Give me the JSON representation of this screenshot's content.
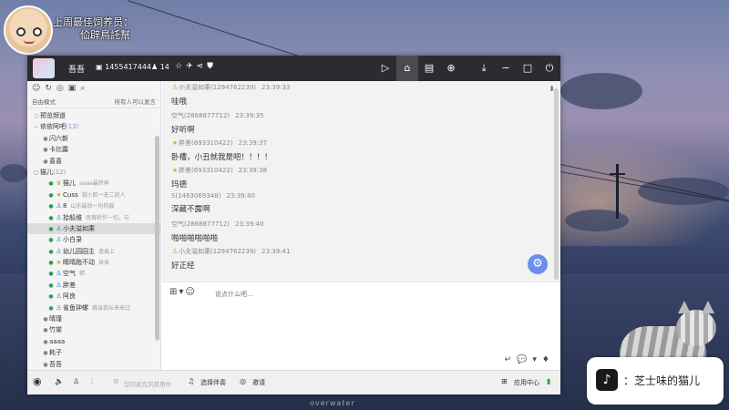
{
  "overlay": {
    "caption_line1": "上周最佳饲养员：",
    "caption_line2": "佡辟鳥託幫",
    "watermark": "overwater"
  },
  "titlebar": {
    "username": "吾吾",
    "id": "1455417444",
    "fans": "14",
    "icons": [
      "star-icon",
      "plane-icon",
      "share-icon",
      "shield-icon"
    ],
    "right_icons": [
      "play-icon",
      "home-icon",
      "list-icon",
      "gamepad-icon",
      "download-icon",
      "minimize-icon",
      "maximize-icon",
      "power-icon"
    ]
  },
  "sidebar": {
    "mode_label": "自由模式",
    "permission": "所有人可以发言",
    "tree": [
      {
        "type": "channel",
        "label": "预览频道",
        "bullet": "○"
      },
      {
        "type": "channel",
        "label": "依依阿吧",
        "count": "(13)",
        "bullet": "−"
      },
      {
        "type": "sub",
        "label": "闪六新",
        "bullet": "●"
      },
      {
        "type": "sub",
        "label": "卡比露",
        "bullet": "●"
      },
      {
        "type": "sub",
        "label": "喜喜",
        "bullet": "●"
      },
      {
        "type": "channel",
        "label": "猫儿",
        "count": "(12)",
        "bullet": "□"
      },
      {
        "type": "user",
        "label": "猫儿",
        "tag": "aaaa最终神",
        "badge": "♛"
      },
      {
        "type": "user",
        "label": "Cuss",
        "tag": "我小脸一无二的人",
        "badge": "★"
      },
      {
        "type": "user",
        "label": "8",
        "tag": "山东最后一份伤痕",
        "badge": "♙"
      },
      {
        "type": "user",
        "label": "拾船维",
        "tag": "南首听作一切，与",
        "badge": "♙"
      },
      {
        "type": "user",
        "label": "小夫溢如乘",
        "tag": "",
        "badge": "♙",
        "selected": true
      },
      {
        "type": "user",
        "label": "小白录",
        "tag": "",
        "badge": "♙"
      },
      {
        "type": "user",
        "label": "幼儿园园主",
        "tag": "遥县上",
        "badge": "♙"
      },
      {
        "type": "user",
        "label": "睛晴跑不动",
        "tag": "哀哀",
        "badge": "★"
      },
      {
        "type": "user",
        "label": "空气",
        "tag": "稀",
        "badge": "♙"
      },
      {
        "type": "user",
        "label": "胖差",
        "tag": "",
        "badge": "♙"
      },
      {
        "type": "user",
        "label": "阿良",
        "tag": "",
        "badge": "♙"
      },
      {
        "type": "user",
        "label": "雀鱼钟螺",
        "tag": "跳当我从来来过",
        "badge": "♙"
      },
      {
        "type": "sub",
        "label": "晴瑾",
        "bullet": "●"
      },
      {
        "type": "sub",
        "label": "竹棠",
        "bullet": "●"
      },
      {
        "type": "sub",
        "label": "aaaa",
        "bullet": "●"
      },
      {
        "type": "sub",
        "label": "耗子",
        "bullet": "●"
      },
      {
        "type": "sub",
        "label": "吾吾",
        "bullet": "●"
      }
    ]
  },
  "chat": {
    "messages": [
      {
        "name": "小夫溢如乘(1294762239)",
        "time": "23:39:33",
        "text": "哇哦",
        "badge": "♙"
      },
      {
        "name": "空气(2868877712)",
        "time": "23:39:35",
        "text": "好听啊",
        "badge": ""
      },
      {
        "name": "胖差(693310422)",
        "time": "23:39:37",
        "text": "卧槽，小丑就我是吧！！！！",
        "badge": "★"
      },
      {
        "name": "胖差(693310422)",
        "time": "23:39:38",
        "text": "玛德",
        "badge": "★"
      },
      {
        "name": "S(1463069348)",
        "time": "23:39:40",
        "text": "深藏不露啊",
        "badge": ""
      },
      {
        "name": "空气(2868877712)",
        "time": "23:39:40",
        "text": "啪啪啪啪啪啪",
        "badge": ""
      },
      {
        "name": "小夫溢如乘(1294762239)",
        "time": "23:39:41",
        "text": "好正经",
        "badge": "♙"
      }
    ]
  },
  "input": {
    "placeholder": "说点什么吧..."
  },
  "bottombar": {
    "mic_hint": "您的麦克风禁用中",
    "choose_accompany": "选择伴奏",
    "invite": "邀请",
    "app_center": "应用中心"
  },
  "sticker": {
    "label": "：芝士味的猫儿"
  },
  "colors": {
    "titlebar": "#2b2b30",
    "float_button": "#6b8fe8"
  }
}
